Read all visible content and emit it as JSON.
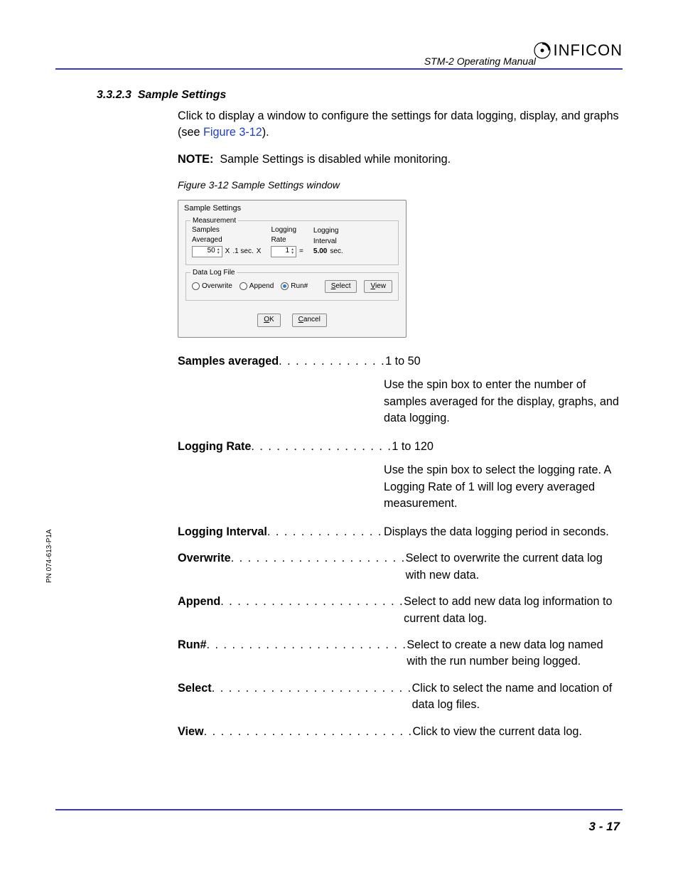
{
  "header": {
    "doc_title": "STM-2 Operating Manual",
    "brand": "INFICON"
  },
  "side_pn": "PN 074-613-P1A",
  "section": {
    "number": "3.3.2.3",
    "title": "Sample Settings"
  },
  "intro": {
    "p1a": "Click to display a window to configure the settings for data logging, display, and graphs (see ",
    "p1_link": "Figure 3-12",
    "p1b": ").",
    "note_label": "NOTE:",
    "note_text": "Sample Settings is disabled while monitoring."
  },
  "figure": {
    "caption": "Figure 3-12  Sample Settings window",
    "dialog_title": "Sample Settings",
    "grp_measurement": "Measurement",
    "samples_averaged_lbl1": "Samples",
    "samples_averaged_lbl2": "Averaged",
    "samples_val": "50",
    "x1": "X",
    "sec1": ".1 sec.",
    "x2": "X",
    "logging_rate_lbl1": "Logging",
    "logging_rate_lbl2": "Rate",
    "logging_rate_val": "1",
    "eq": "=",
    "logging_interval_lbl1": "Logging",
    "logging_interval_lbl2": "Interval",
    "logging_interval_val": "5.00",
    "sec2": "sec.",
    "grp_datalog": "Data Log File",
    "overwrite": "Overwrite",
    "append": "Append",
    "runnum": "Run#",
    "select_btn": "Select",
    "view_btn": "View",
    "ok_btn": "OK",
    "cancel_btn": "Cancel"
  },
  "defs": {
    "samples_averaged": {
      "term": "Samples averaged",
      "dots": " . . . . . . . . . . . . .",
      "value": "1 to 50",
      "desc": "Use the spin box to enter the number of samples averaged for the display, graphs, and data logging."
    },
    "logging_rate": {
      "term": "Logging Rate",
      "dots": " . . . . . . . . . . . . . . . . .",
      "value": "1 to 120",
      "desc": "Use the spin box to select the logging rate. A Logging Rate of 1 will log every averaged measurement."
    },
    "logging_interval": {
      "term": "Logging Interval",
      "dots": " . . . . . . . . . . . . . .",
      "value": "Displays the data logging period in seconds."
    },
    "overwrite": {
      "term": "Overwrite",
      "dots": ". . . . . . . . . . . . . . . . . . . . .",
      "value": "Select to overwrite the current data log with new data."
    },
    "append": {
      "term": "Append",
      "dots": " . . . . . . . . . . . . . . . . . . . . . .",
      "value": "Select to add new data log information to current data log."
    },
    "runnum": {
      "term": "Run#",
      "dots": " . . . . . . . . . . . . . . . . . . . . . . . .",
      "value": "Select to create a new data log named with the run number being logged."
    },
    "select": {
      "term": "Select",
      "dots": ". . . . . . . . . . . . . . . . . . . . . . . .",
      "value": "Click to select the name and location of data log files."
    },
    "view": {
      "term": "View",
      "dots": " . . . . . . . . . . . . . . . . . . . . . . . . .",
      "value": "Click to view the current data log."
    }
  },
  "footer": {
    "page": "3 - 17"
  }
}
